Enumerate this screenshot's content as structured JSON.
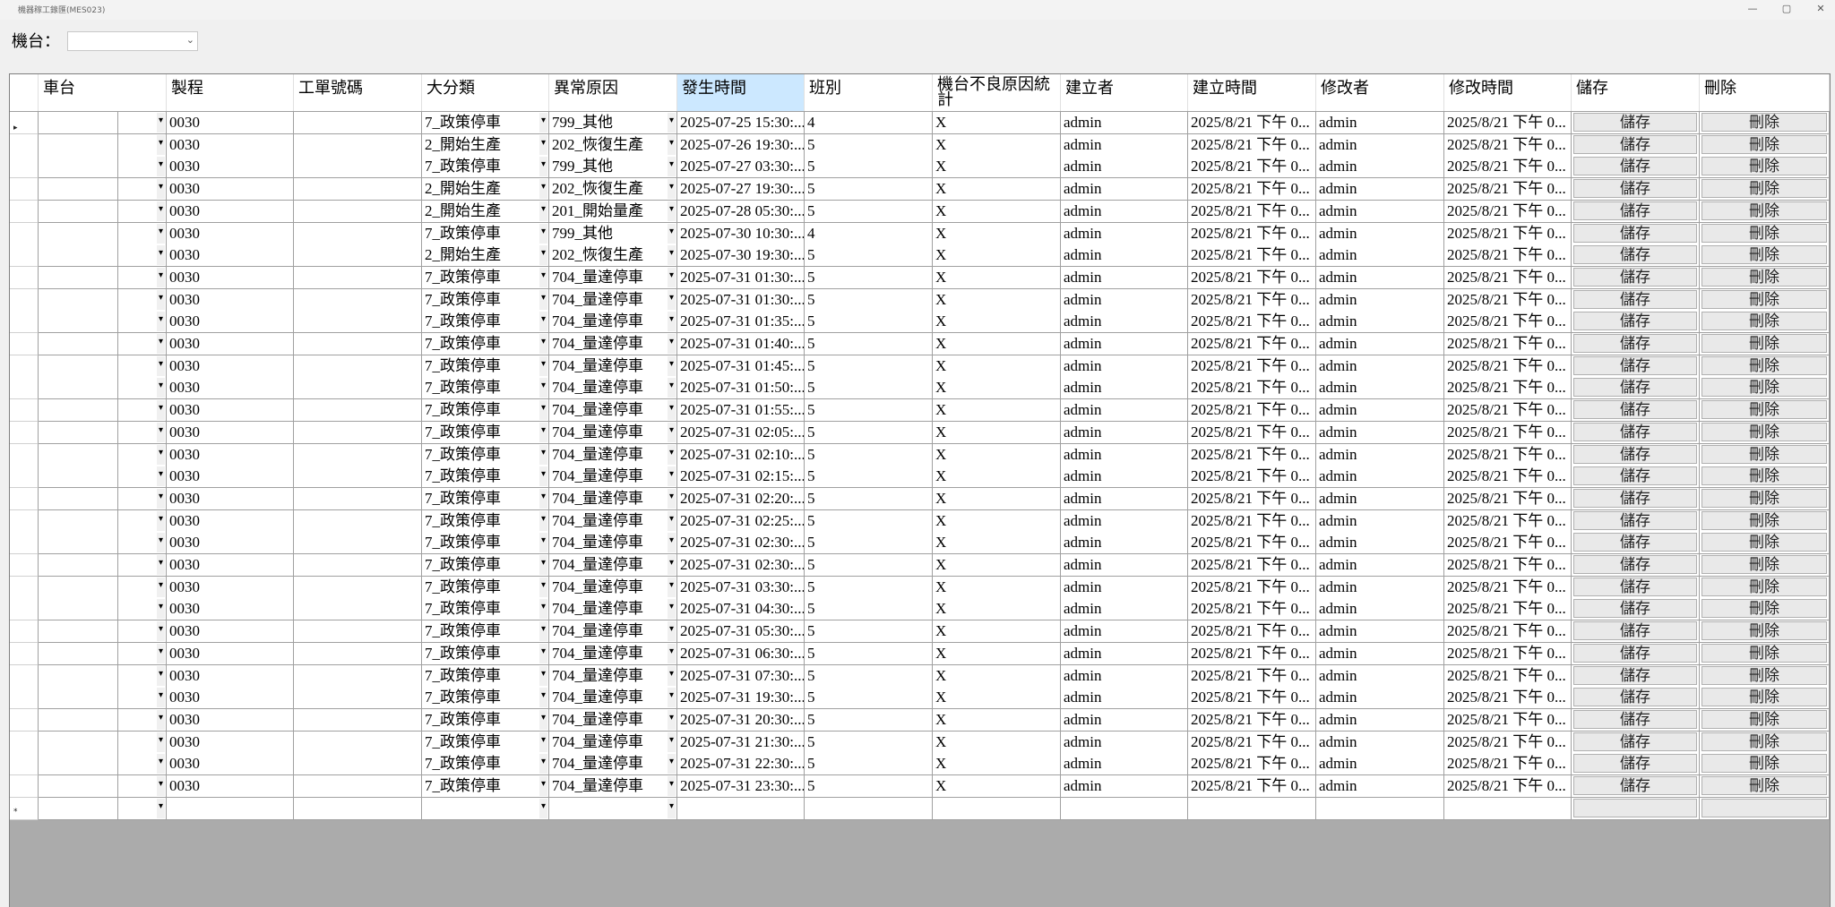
{
  "window": {
    "title": "機器稼工錄匯(MES023)",
    "minimize_glyph": "—",
    "restore_glyph": "▢",
    "close_glyph": "✕"
  },
  "toolbar": {
    "machine_label": "機台：",
    "machine_value": ""
  },
  "grid": {
    "columns": [
      "車台",
      "製程",
      "工單號碼",
      "大分類",
      "異常原因",
      "發生時間",
      "班別",
      "機台不良原因統計",
      "建立者",
      "建立時間",
      "修改者",
      "修改時間",
      "儲存",
      "刪除"
    ],
    "save_label": "儲存",
    "delete_label": "刪除",
    "rows": [
      {
        "proc": "0030",
        "cat": "7_政策停車",
        "reason": "799_其他",
        "time": "2025-07-25 15:30:...",
        "shift": "4",
        "stat": "X",
        "creator": "admin",
        "ctime": "2025/8/21 下午 0...",
        "modifier": "admin",
        "mtime": "2025/8/21 下午 0..."
      },
      {
        "proc": "0030",
        "cat": "2_開始生產",
        "reason": "202_恢復生產",
        "time": "2025-07-26 19:30:...",
        "shift": "5",
        "stat": "X",
        "creator": "admin",
        "ctime": "2025/8/21 下午 0...",
        "modifier": "admin",
        "mtime": "2025/8/21 下午 0..."
      },
      {
        "proc": "0030",
        "cat": "7_政策停車",
        "reason": "799_其他",
        "time": "2025-07-27 03:30:...",
        "shift": "5",
        "stat": "X",
        "creator": "admin",
        "ctime": "2025/8/21 下午 0...",
        "modifier": "admin",
        "mtime": "2025/8/21 下午 0..."
      },
      {
        "proc": "0030",
        "cat": "2_開始生產",
        "reason": "202_恢復生產",
        "time": "2025-07-27 19:30:...",
        "shift": "5",
        "stat": "X",
        "creator": "admin",
        "ctime": "2025/8/21 下午 0...",
        "modifier": "admin",
        "mtime": "2025/8/21 下午 0..."
      },
      {
        "proc": "0030",
        "cat": "2_開始生產",
        "reason": "201_開始量產",
        "time": "2025-07-28 05:30:...",
        "shift": "5",
        "stat": "X",
        "creator": "admin",
        "ctime": "2025/8/21 下午 0...",
        "modifier": "admin",
        "mtime": "2025/8/21 下午 0..."
      },
      {
        "proc": "0030",
        "cat": "7_政策停車",
        "reason": "799_其他",
        "time": "2025-07-30 10:30:...",
        "shift": "4",
        "stat": "X",
        "creator": "admin",
        "ctime": "2025/8/21 下午 0...",
        "modifier": "admin",
        "mtime": "2025/8/21 下午 0..."
      },
      {
        "proc": "0030",
        "cat": "2_開始生產",
        "reason": "202_恢復生產",
        "time": "2025-07-30 19:30:...",
        "shift": "5",
        "stat": "X",
        "creator": "admin",
        "ctime": "2025/8/21 下午 0...",
        "modifier": "admin",
        "mtime": "2025/8/21 下午 0..."
      },
      {
        "proc": "0030",
        "cat": "7_政策停車",
        "reason": "704_量達停車",
        "time": "2025-07-31 01:30:...",
        "shift": "5",
        "stat": "X",
        "creator": "admin",
        "ctime": "2025/8/21 下午 0...",
        "modifier": "admin",
        "mtime": "2025/8/21 下午 0..."
      },
      {
        "proc": "0030",
        "cat": "7_政策停車",
        "reason": "704_量達停車",
        "time": "2025-07-31 01:30:...",
        "shift": "5",
        "stat": "X",
        "creator": "admin",
        "ctime": "2025/8/21 下午 0...",
        "modifier": "admin",
        "mtime": "2025/8/21 下午 0..."
      },
      {
        "proc": "0030",
        "cat": "7_政策停車",
        "reason": "704_量達停車",
        "time": "2025-07-31 01:35:...",
        "shift": "5",
        "stat": "X",
        "creator": "admin",
        "ctime": "2025/8/21 下午 0...",
        "modifier": "admin",
        "mtime": "2025/8/21 下午 0..."
      },
      {
        "proc": "0030",
        "cat": "7_政策停車",
        "reason": "704_量達停車",
        "time": "2025-07-31 01:40:...",
        "shift": "5",
        "stat": "X",
        "creator": "admin",
        "ctime": "2025/8/21 下午 0...",
        "modifier": "admin",
        "mtime": "2025/8/21 下午 0..."
      },
      {
        "proc": "0030",
        "cat": "7_政策停車",
        "reason": "704_量達停車",
        "time": "2025-07-31 01:45:...",
        "shift": "5",
        "stat": "X",
        "creator": "admin",
        "ctime": "2025/8/21 下午 0...",
        "modifier": "admin",
        "mtime": "2025/8/21 下午 0..."
      },
      {
        "proc": "0030",
        "cat": "7_政策停車",
        "reason": "704_量達停車",
        "time": "2025-07-31 01:50:...",
        "shift": "5",
        "stat": "X",
        "creator": "admin",
        "ctime": "2025/8/21 下午 0...",
        "modifier": "admin",
        "mtime": "2025/8/21 下午 0..."
      },
      {
        "proc": "0030",
        "cat": "7_政策停車",
        "reason": "704_量達停車",
        "time": "2025-07-31 01:55:...",
        "shift": "5",
        "stat": "X",
        "creator": "admin",
        "ctime": "2025/8/21 下午 0...",
        "modifier": "admin",
        "mtime": "2025/8/21 下午 0..."
      },
      {
        "proc": "0030",
        "cat": "7_政策停車",
        "reason": "704_量達停車",
        "time": "2025-07-31 02:05:...",
        "shift": "5",
        "stat": "X",
        "creator": "admin",
        "ctime": "2025/8/21 下午 0...",
        "modifier": "admin",
        "mtime": "2025/8/21 下午 0..."
      },
      {
        "proc": "0030",
        "cat": "7_政策停車",
        "reason": "704_量達停車",
        "time": "2025-07-31 02:10:...",
        "shift": "5",
        "stat": "X",
        "creator": "admin",
        "ctime": "2025/8/21 下午 0...",
        "modifier": "admin",
        "mtime": "2025/8/21 下午 0..."
      },
      {
        "proc": "0030",
        "cat": "7_政策停車",
        "reason": "704_量達停車",
        "time": "2025-07-31 02:15:...",
        "shift": "5",
        "stat": "X",
        "creator": "admin",
        "ctime": "2025/8/21 下午 0...",
        "modifier": "admin",
        "mtime": "2025/8/21 下午 0..."
      },
      {
        "proc": "0030",
        "cat": "7_政策停車",
        "reason": "704_量達停車",
        "time": "2025-07-31 02:20:...",
        "shift": "5",
        "stat": "X",
        "creator": "admin",
        "ctime": "2025/8/21 下午 0...",
        "modifier": "admin",
        "mtime": "2025/8/21 下午 0..."
      },
      {
        "proc": "0030",
        "cat": "7_政策停車",
        "reason": "704_量達停車",
        "time": "2025-07-31 02:25:...",
        "shift": "5",
        "stat": "X",
        "creator": "admin",
        "ctime": "2025/8/21 下午 0...",
        "modifier": "admin",
        "mtime": "2025/8/21 下午 0..."
      },
      {
        "proc": "0030",
        "cat": "7_政策停車",
        "reason": "704_量達停車",
        "time": "2025-07-31 02:30:...",
        "shift": "5",
        "stat": "X",
        "creator": "admin",
        "ctime": "2025/8/21 下午 0...",
        "modifier": "admin",
        "mtime": "2025/8/21 下午 0..."
      },
      {
        "proc": "0030",
        "cat": "7_政策停車",
        "reason": "704_量達停車",
        "time": "2025-07-31 02:30:...",
        "shift": "5",
        "stat": "X",
        "creator": "admin",
        "ctime": "2025/8/21 下午 0...",
        "modifier": "admin",
        "mtime": "2025/8/21 下午 0..."
      },
      {
        "proc": "0030",
        "cat": "7_政策停車",
        "reason": "704_量達停車",
        "time": "2025-07-31 03:30:...",
        "shift": "5",
        "stat": "X",
        "creator": "admin",
        "ctime": "2025/8/21 下午 0...",
        "modifier": "admin",
        "mtime": "2025/8/21 下午 0..."
      },
      {
        "proc": "0030",
        "cat": "7_政策停車",
        "reason": "704_量達停車",
        "time": "2025-07-31 04:30:...",
        "shift": "5",
        "stat": "X",
        "creator": "admin",
        "ctime": "2025/8/21 下午 0...",
        "modifier": "admin",
        "mtime": "2025/8/21 下午 0..."
      },
      {
        "proc": "0030",
        "cat": "7_政策停車",
        "reason": "704_量達停車",
        "time": "2025-07-31 05:30:...",
        "shift": "5",
        "stat": "X",
        "creator": "admin",
        "ctime": "2025/8/21 下午 0...",
        "modifier": "admin",
        "mtime": "2025/8/21 下午 0..."
      },
      {
        "proc": "0030",
        "cat": "7_政策停車",
        "reason": "704_量達停車",
        "time": "2025-07-31 06:30:...",
        "shift": "5",
        "stat": "X",
        "creator": "admin",
        "ctime": "2025/8/21 下午 0...",
        "modifier": "admin",
        "mtime": "2025/8/21 下午 0..."
      },
      {
        "proc": "0030",
        "cat": "7_政策停車",
        "reason": "704_量達停車",
        "time": "2025-07-31 07:30:...",
        "shift": "5",
        "stat": "X",
        "creator": "admin",
        "ctime": "2025/8/21 下午 0...",
        "modifier": "admin",
        "mtime": "2025/8/21 下午 0..."
      },
      {
        "proc": "0030",
        "cat": "7_政策停車",
        "reason": "704_量達停車",
        "time": "2025-07-31 19:30:...",
        "shift": "5",
        "stat": "X",
        "creator": "admin",
        "ctime": "2025/8/21 下午 0...",
        "modifier": "admin",
        "mtime": "2025/8/21 下午 0..."
      },
      {
        "proc": "0030",
        "cat": "7_政策停車",
        "reason": "704_量達停車",
        "time": "2025-07-31 20:30:...",
        "shift": "5",
        "stat": "X",
        "creator": "admin",
        "ctime": "2025/8/21 下午 0...",
        "modifier": "admin",
        "mtime": "2025/8/21 下午 0..."
      },
      {
        "proc": "0030",
        "cat": "7_政策停車",
        "reason": "704_量達停車",
        "time": "2025-07-31 21:30:...",
        "shift": "5",
        "stat": "X",
        "creator": "admin",
        "ctime": "2025/8/21 下午 0...",
        "modifier": "admin",
        "mtime": "2025/8/21 下午 0..."
      },
      {
        "proc": "0030",
        "cat": "7_政策停車",
        "reason": "704_量達停車",
        "time": "2025-07-31 22:30:...",
        "shift": "5",
        "stat": "X",
        "creator": "admin",
        "ctime": "2025/8/21 下午 0...",
        "modifier": "admin",
        "mtime": "2025/8/21 下午 0..."
      },
      {
        "proc": "0030",
        "cat": "7_政策停車",
        "reason": "704_量達停車",
        "time": "2025-07-31 23:30:...",
        "shift": "5",
        "stat": "X",
        "creator": "admin",
        "ctime": "2025/8/21 下午 0...",
        "modifier": "admin",
        "mtime": "2025/8/21 下午 0..."
      }
    ],
    "current_row_marker": "▸",
    "new_row_marker": "*"
  }
}
